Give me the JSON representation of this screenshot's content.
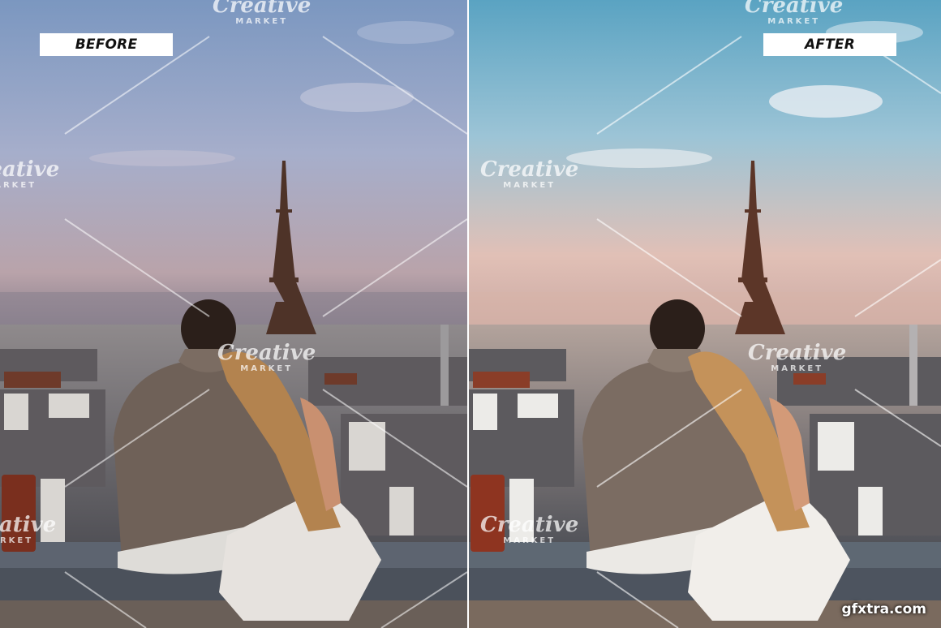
{
  "labels": {
    "before": "BEFORE",
    "after": "AFTER"
  },
  "watermark": {
    "line1": "Creative",
    "line2": "MARKET"
  },
  "site": "gfxtra.com",
  "colors": {
    "before_sky_top": "#7f9bc0",
    "before_sky_bottom": "#b89a9e",
    "after_sky_top": "#5fa6c4",
    "after_sky_bottom": "#e3b8a8",
    "tower": "#5a3a2c",
    "hoodie": "#7b6c62",
    "hair": "#b98a58",
    "dress": "#e9e6e2"
  }
}
